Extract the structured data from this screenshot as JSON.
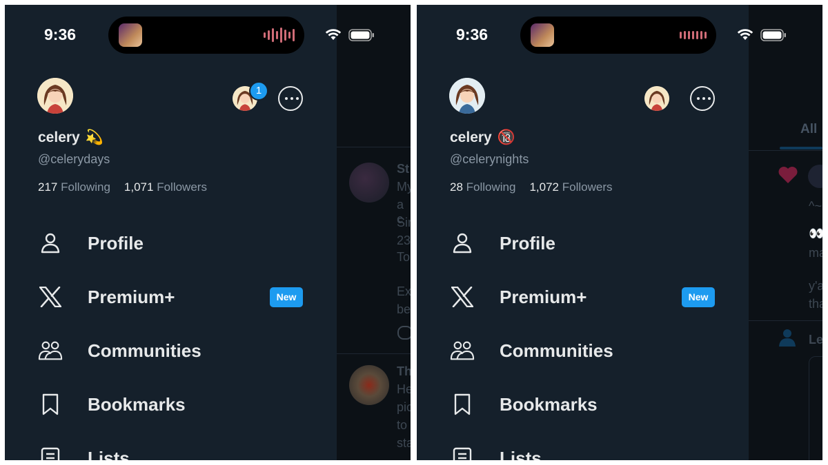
{
  "panels": [
    {
      "status": {
        "time": "9:36"
      },
      "island": {
        "art_icon": "album-art",
        "wave_icon": "audio-waveform-icon"
      },
      "profile": {
        "display_name": "celery",
        "name_emoji": "💫",
        "handle": "@celerydays",
        "following_count": "217",
        "following_label": "Following",
        "followers_count": "1,071",
        "followers_label": "Followers",
        "account_badge": "1"
      },
      "menu": [
        {
          "label": "Profile",
          "icon": "person-icon"
        },
        {
          "label": "Premium+",
          "icon": "x-logo-icon",
          "badge": "New"
        },
        {
          "label": "Communities",
          "icon": "communities-icon"
        },
        {
          "label": "Bookmarks",
          "icon": "bookmark-icon"
        },
        {
          "label": "Lists",
          "icon": "lists-icon"
        }
      ],
      "background_fragments": [
        "St",
        "My",
        "a c",
        "Sir",
        "23",
        "To",
        "Ex",
        "be",
        "Th",
        "He",
        "pic",
        "to",
        "sta"
      ]
    },
    {
      "status": {
        "time": "9:36"
      },
      "island": {
        "art_icon": "album-art",
        "wave_icon": "audio-waveform-icon"
      },
      "profile": {
        "display_name": "celery",
        "name_emoji": "🔞",
        "handle": "@celerynights",
        "following_count": "28",
        "following_label": "Following",
        "followers_count": "1,072",
        "followers_label": "Followers"
      },
      "menu": [
        {
          "label": "Profile",
          "icon": "person-icon"
        },
        {
          "label": "Premium+",
          "icon": "x-logo-icon",
          "badge": "New"
        },
        {
          "label": "Communities",
          "icon": "communities-icon"
        },
        {
          "label": "Bookmarks",
          "icon": "bookmark-icon"
        },
        {
          "label": "Lists",
          "icon": "lists-icon"
        }
      ],
      "background_fragments": [
        "All",
        "^~",
        "👀",
        "ma",
        "y'a",
        "tha",
        "Le"
      ]
    }
  ],
  "colors": {
    "drawer_bg": "#15202b",
    "accent_blue": "#1d9bf0",
    "primary_text": "#e7e9ea",
    "secondary_text": "#8b98a5"
  }
}
